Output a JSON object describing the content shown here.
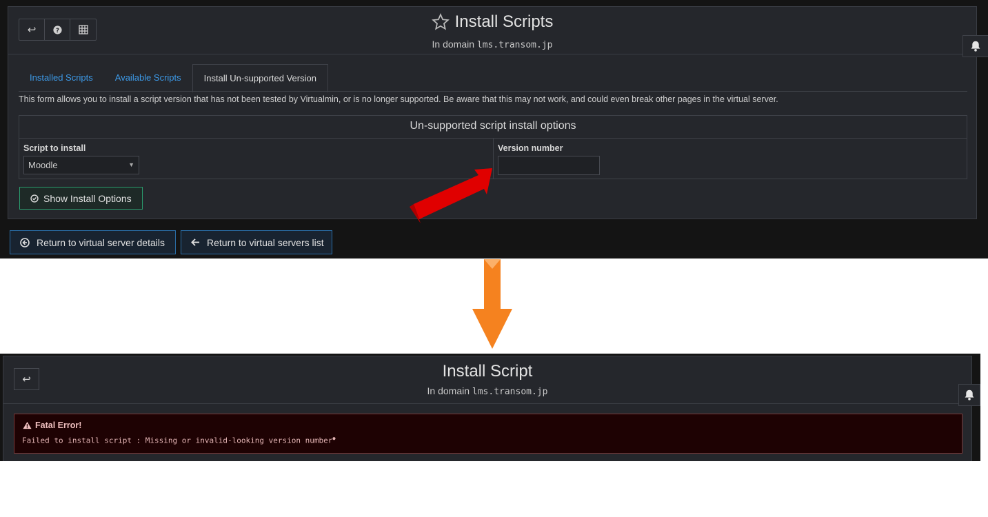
{
  "top_screen": {
    "toolbar": {
      "back_icon": "return-arrow-icon",
      "help_icon": "question-circle-icon",
      "grid_icon": "grid-icon"
    },
    "header": {
      "title": "Install Scripts",
      "subtitle_prefix": "In domain",
      "domain": "lms.transom.jp"
    },
    "tabs": [
      {
        "label": "Installed Scripts"
      },
      {
        "label": "Available Scripts"
      },
      {
        "label": "Install Un-supported Version"
      }
    ],
    "description": "This form allows you to install a script version that has not been tested by Virtualmin, or is no longer supported. Be aware that this may not work, and could even break other pages in the virtual server.",
    "options": {
      "heading": "Un-supported script install options",
      "script_label": "Script to install",
      "script_value": "Moodle",
      "version_label": "Version number",
      "version_value": ""
    },
    "show_button": "Show Install Options",
    "return_details": "Return to virtual server details",
    "return_list": "Return to virtual servers list"
  },
  "bottom_screen": {
    "header": {
      "title": "Install Script",
      "subtitle_prefix": "In domain",
      "domain": "lms.transom.jp"
    },
    "error": {
      "title": "Fatal Error!",
      "message": "Failed to install script : Missing or invalid-looking version number"
    }
  },
  "colors": {
    "link": "#3d9ae8",
    "arrow_red": "#e00000",
    "arrow_orange": "#f5821f",
    "error_bg": "#1e0203"
  }
}
